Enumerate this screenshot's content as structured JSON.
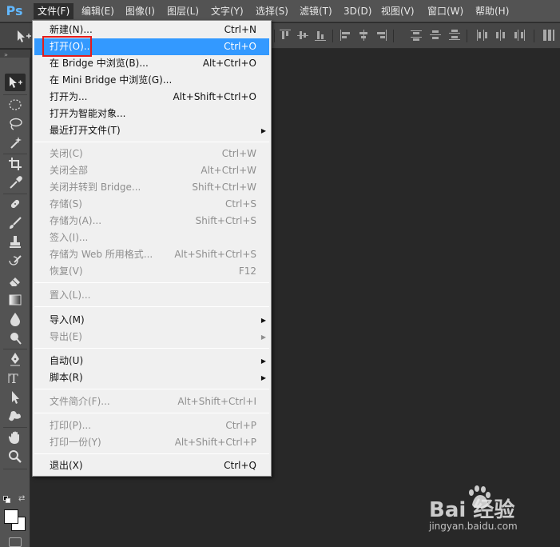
{
  "app": {
    "logo": "Ps"
  },
  "menubar": {
    "items": [
      {
        "label": "文件(F)"
      },
      {
        "label": "编辑(E)"
      },
      {
        "label": "图像(I)"
      },
      {
        "label": "图层(L)"
      },
      {
        "label": "文字(Y)"
      },
      {
        "label": "选择(S)"
      },
      {
        "label": "滤镜(T)"
      },
      {
        "label": "3D(D)"
      },
      {
        "label": "视图(V)"
      },
      {
        "label": "窗口(W)"
      },
      {
        "label": "帮助(H)"
      }
    ],
    "active_index": 0
  },
  "file_menu": {
    "items": [
      {
        "label": "新建(N)...",
        "shortcut": "Ctrl+N",
        "enabled": true
      },
      {
        "label": "打开(O)...",
        "shortcut": "Ctrl+O",
        "enabled": true,
        "highlighted": true
      },
      {
        "label": "在 Bridge 中浏览(B)...",
        "shortcut": "Alt+Ctrl+O",
        "enabled": true
      },
      {
        "label": "在 Mini Bridge 中浏览(G)...",
        "shortcut": "",
        "enabled": true
      },
      {
        "label": "打开为...",
        "shortcut": "Alt+Shift+Ctrl+O",
        "enabled": true
      },
      {
        "label": "打开为智能对象...",
        "shortcut": "",
        "enabled": true
      },
      {
        "label": "最近打开文件(T)",
        "shortcut": "",
        "enabled": true,
        "submenu": true
      },
      {
        "label": "关闭(C)",
        "shortcut": "Ctrl+W",
        "enabled": false
      },
      {
        "label": "关闭全部",
        "shortcut": "Alt+Ctrl+W",
        "enabled": false
      },
      {
        "label": "关闭并转到 Bridge...",
        "shortcut": "Shift+Ctrl+W",
        "enabled": false
      },
      {
        "label": "存储(S)",
        "shortcut": "Ctrl+S",
        "enabled": false
      },
      {
        "label": "存储为(A)...",
        "shortcut": "Shift+Ctrl+S",
        "enabled": false
      },
      {
        "label": "签入(I)...",
        "shortcut": "",
        "enabled": false
      },
      {
        "label": "存储为 Web 所用格式...",
        "shortcut": "Alt+Shift+Ctrl+S",
        "enabled": false
      },
      {
        "label": "恢复(V)",
        "shortcut": "F12",
        "enabled": false
      },
      {
        "label": "置入(L)...",
        "shortcut": "",
        "enabled": false
      },
      {
        "label": "导入(M)",
        "shortcut": "",
        "enabled": true,
        "submenu": true
      },
      {
        "label": "导出(E)",
        "shortcut": "",
        "enabled": false,
        "submenu": true
      },
      {
        "label": "自动(U)",
        "shortcut": "",
        "enabled": true,
        "submenu": true
      },
      {
        "label": "脚本(R)",
        "shortcut": "",
        "enabled": true,
        "submenu": true
      },
      {
        "label": "文件简介(F)...",
        "shortcut": "Alt+Shift+Ctrl+I",
        "enabled": false
      },
      {
        "label": "打印(P)...",
        "shortcut": "Ctrl+P",
        "enabled": false
      },
      {
        "label": "打印一份(Y)",
        "shortcut": "Alt+Shift+Ctrl+P",
        "enabled": false
      },
      {
        "label": "退出(X)",
        "shortcut": "Ctrl+Q",
        "enabled": true
      }
    ]
  },
  "tools": [
    "move-tool-icon",
    "marquee-tool-icon",
    "lasso-tool-icon",
    "magic-wand-tool-icon",
    "crop-tool-icon",
    "eyedropper-tool-icon",
    "healing-brush-tool-icon",
    "brush-tool-icon",
    "clone-stamp-tool-icon",
    "history-brush-tool-icon",
    "eraser-tool-icon",
    "gradient-tool-icon",
    "blur-tool-icon",
    "dodge-tool-icon",
    "pen-tool-icon",
    "type-tool-icon",
    "path-selection-tool-icon",
    "custom-shape-tool-icon",
    "hand-tool-icon",
    "zoom-tool-icon"
  ],
  "colors": {
    "accent_highlight": "#3399ff",
    "annotation_box": "#e41c1c",
    "foreground": "#ffffff",
    "background": "#ffffff"
  },
  "watermark": {
    "logo": "Bai 经验",
    "url": "jingyan.baidu.com"
  }
}
